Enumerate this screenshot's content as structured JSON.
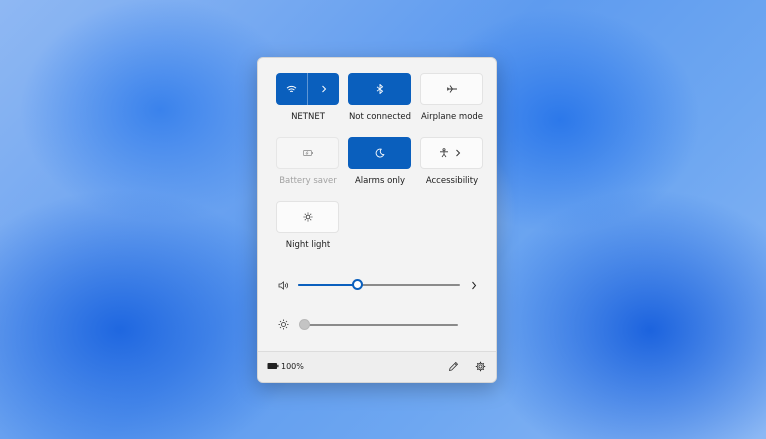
{
  "quick_settings": {
    "tiles": {
      "wifi": {
        "label": "NETNET",
        "icon": "wifi-icon",
        "state": "on"
      },
      "bluetooth": {
        "label": "Not connected",
        "icon": "bluetooth-icon",
        "state": "on"
      },
      "airplane": {
        "label": "Airplane mode",
        "icon": "airplane-icon",
        "state": "off"
      },
      "battery_saver": {
        "label": "Battery saver",
        "icon": "battery-saver-icon",
        "state": "disabled"
      },
      "focus": {
        "label": "Alarms only",
        "icon": "moon-icon",
        "state": "on"
      },
      "accessibility": {
        "label": "Accessibility",
        "icon": "accessibility-icon",
        "state": "off"
      },
      "night_light": {
        "label": "Night light",
        "icon": "sun-icon",
        "state": "off"
      }
    },
    "volume": {
      "icon": "speaker-icon",
      "level": 0.37
    },
    "brightness": {
      "icon": "brightness-icon",
      "level": 0.0
    },
    "footer": {
      "battery_percent": "100%",
      "battery_icon": "battery-icon",
      "edit_icon": "pencil-icon",
      "settings_icon": "gear-icon"
    }
  },
  "colors": {
    "accent": "#0a5fbd",
    "panel_bg": "#f3f3f3"
  }
}
